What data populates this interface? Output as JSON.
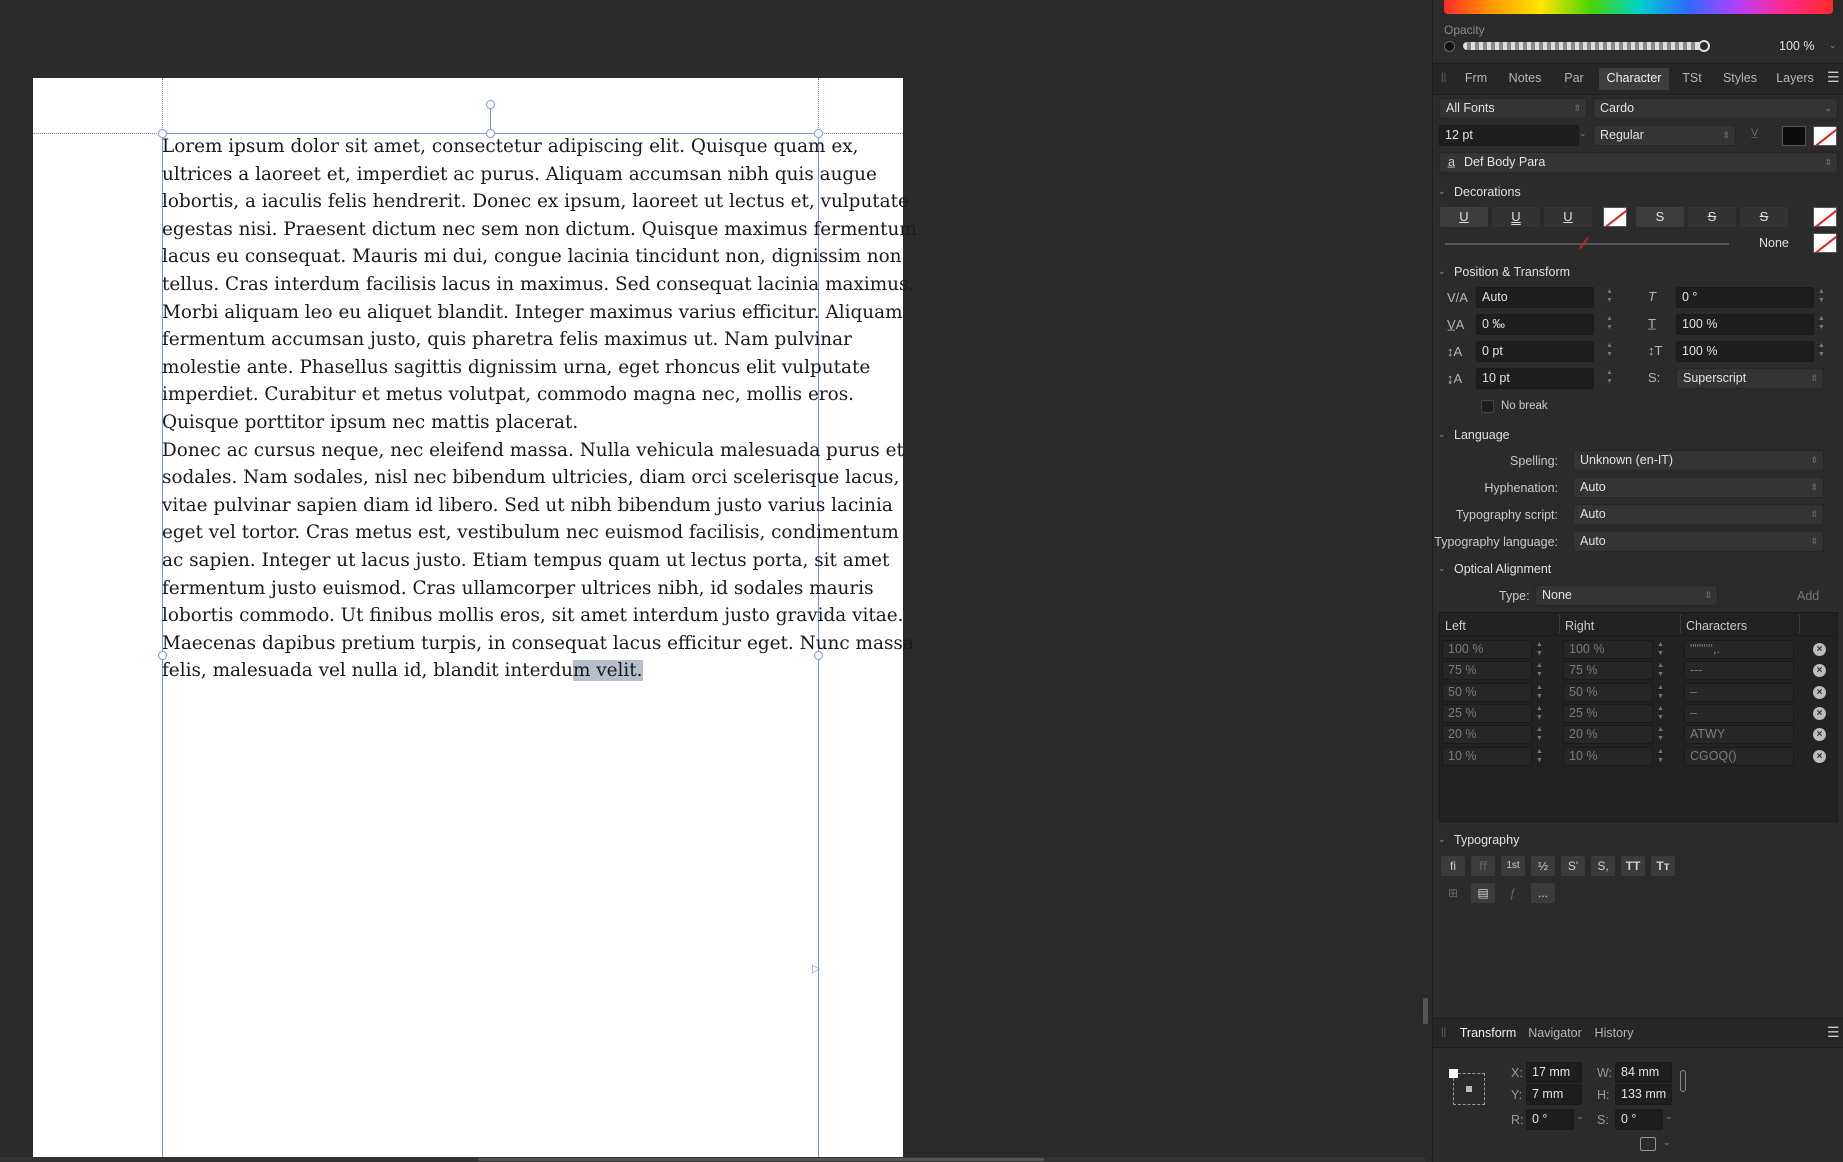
{
  "document": {
    "paragraphs": [
      [
        "Lorem ipsum dolor sit amet, consectetur adipiscing elit. Quisque quam ex,",
        "ultrices a laoreet et, imperdiet ac purus. Aliquam accumsan nibh quis augue",
        "lobortis, a iaculis felis hendrerit. Donec ex ipsum, laoreet ut lectus et, vulputate",
        "egestas nisi. Praesent dictum nec sem non dictum. Quisque maximus fermentum",
        "lacus eu consequat. Mauris mi dui, congue lacinia tincidunt non, dignissim non",
        "tellus. Cras interdum facilisis lacus in maximus. Sed consequat lacinia maximus.",
        "Morbi aliquam leo eu aliquet blandit. Integer maximus varius efficitur. Aliquam",
        "fermentum accumsan justo, quis pharetra felis maximus ut. Nam pulvinar",
        "molestie ante. Phasellus sagittis dignissim urna, eget rhoncus elit vulputate",
        "imperdiet. Curabitur et metus volutpat, commodo magna nec, mollis eros.",
        "Quisque porttitor ipsum nec mattis placerat."
      ],
      [
        "Donec ac cursus neque, nec eleifend massa. Nulla vehicula malesuada purus et",
        "sodales. Nam sodales, nisl nec bibendum ultricies, diam orci scelerisque lacus,",
        "vitae pulvinar sapien diam id libero. Sed ut nibh bibendum justo varius lacinia",
        "eget vel tortor. Cras metus est, vestibulum nec euismod facilisis, condimentum",
        "ac sapien. Integer ut lacus justo. Etiam tempus quam ut lectus porta, sit amet",
        "fermentum justo euismod. Cras ullamcorper ultrices nibh, id sodales mauris",
        "lobortis commodo. Ut finibus mollis eros, sit amet interdum justo gravida vitae.",
        "Maecenas dapibus pretium turpis, in consequat lacus efficitur eget. Nunc massa"
      ]
    ],
    "last_line_before": "felis, malesuada vel nulla id, blandit interdu",
    "last_line_selected": "m velit."
  },
  "colour": {
    "opacity_label": "Opacity",
    "opacity_value": "100 %"
  },
  "tabs": [
    "Frm",
    "Notes",
    "Par",
    "Character",
    "TSt",
    "Styles",
    "Layers"
  ],
  "active_tab": "Character",
  "character": {
    "font_collection": "All Fonts",
    "font_family": "Cardo",
    "font_size": "12 pt",
    "font_style": "Regular",
    "char_style": "Def Body Para"
  },
  "decorations": {
    "title": "Decorations",
    "buttons": [
      "U",
      "U",
      "U",
      "S",
      "S",
      "S"
    ],
    "line_value": "None"
  },
  "position_transform": {
    "title": "Position & Transform",
    "kerning": "Auto",
    "shear": "0 °",
    "tracking": "0 ‰",
    "v_scale": "100 %",
    "baseline": "0 pt",
    "h_scale": "100 %",
    "leading": "10 pt",
    "position": "Superscript",
    "no_break": "No break"
  },
  "language": {
    "title": "Language",
    "spelling_label": "Spelling:",
    "spelling_value": "Unknown (en-IT)",
    "hyphenation_label": "Hyphenation:",
    "hyphenation_value": "Auto",
    "script_label": "Typography script:",
    "script_value": "Auto",
    "lang_label": "Typography language:",
    "lang_value": "Auto"
  },
  "optical": {
    "title": "Optical Alignment",
    "type_label": "Type:",
    "type_value": "None",
    "add_label": "Add",
    "headers": [
      "Left",
      "Right",
      "Characters"
    ],
    "rows": [
      {
        "left": "100 %",
        "right": "100 %",
        "chars": "\"\"\"'''',."
      },
      {
        "left": "75 %",
        "right": "75 %",
        "chars": "---"
      },
      {
        "left": "50 %",
        "right": "50 %",
        "chars": "–"
      },
      {
        "left": "25 %",
        "right": "25 %",
        "chars": "–"
      },
      {
        "left": "20 %",
        "right": "20 %",
        "chars": "ATWY"
      },
      {
        "left": "10 %",
        "right": "10 %",
        "chars": "CGOQ()"
      }
    ]
  },
  "typography": {
    "title": "Typography",
    "row1": [
      "fi",
      "ﬀ",
      "1st",
      "½",
      "S'",
      "S,",
      "TT",
      "Tт"
    ],
    "row2": [
      "⊞",
      "▤",
      "ƒ",
      "..."
    ]
  },
  "bottom_tabs": [
    "Transform",
    "Navigator",
    "History"
  ],
  "transform": {
    "x_label": "X:",
    "x": "17 mm",
    "y_label": "Y:",
    "y": "7 mm",
    "w_label": "W:",
    "w": "84 mm",
    "h_label": "H:",
    "h": "133 mm",
    "r_label": "R:",
    "r": "0 °",
    "s_label": "S:",
    "s": "0 °"
  }
}
